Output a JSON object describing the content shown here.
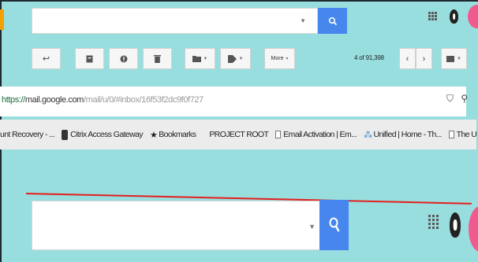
{
  "search_top": {
    "value": "",
    "dropdown_icon": "triangle-down",
    "search_icon": "magnifier"
  },
  "toolbar": {
    "more_label": "More",
    "more_caret": "▾",
    "pagination": "4 of 91,398",
    "buttons": [
      "back-arrow",
      "archive",
      "report-spam",
      "delete",
      "move-to",
      "labels",
      "more",
      "older",
      "newer",
      "settings"
    ]
  },
  "address_bar": {
    "protocol": "https://",
    "host": "mail.google.com",
    "path": "/mail/u/0/#inbox/16f53f2dc9f0f727",
    "icons": [
      "shield-icon",
      "pin-icon"
    ]
  },
  "bookmarks": [
    {
      "label": "unt Recovery - ...",
      "icon": "none"
    },
    {
      "label": "Citrix Access Gateway",
      "icon": "citrix-icon"
    },
    {
      "label": "Bookmarks",
      "icon": "star-icon"
    },
    {
      "label": "PROJECT ROOT",
      "icon": "none"
    },
    {
      "label": "Email Activation | Em...",
      "icon": "doc-icon"
    },
    {
      "label": "Unified | Home - Th...",
      "icon": "wave-icon"
    },
    {
      "label": "The University of Ad...",
      "icon": "doc-icon"
    }
  ],
  "search_bottom": {
    "value": "",
    "dropdown_icon": "triangle-down",
    "search_icon": "magnifier"
  },
  "colors": {
    "background": "#98dede",
    "search_button": "#4787ed",
    "divider": "#e41e1e",
    "avatar": "#ef5b8f",
    "left_tab": "#f4a000"
  }
}
